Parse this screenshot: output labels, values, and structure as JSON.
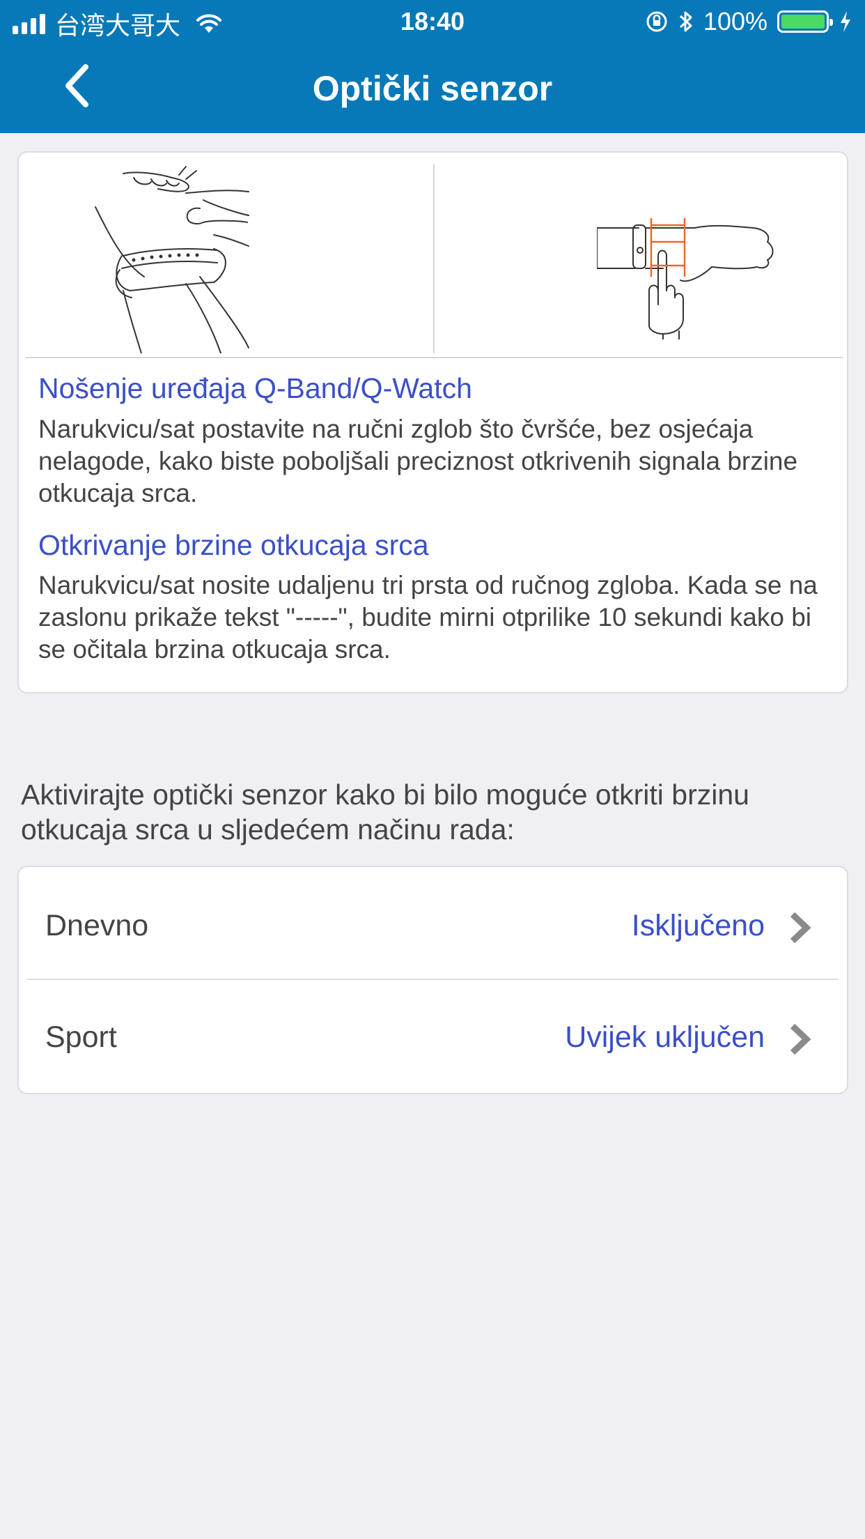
{
  "status_bar": {
    "carrier": "台湾大哥大",
    "time": "18:40",
    "battery": "100%",
    "battery_level": 1.0
  },
  "header": {
    "title": "Optički senzor",
    "back_icon": "chevron-left-icon"
  },
  "info": {
    "sections": [
      {
        "title": "Nošenje uređaja Q-Band/Q-Watch",
        "body": "Narukvicu/sat postavite na ručni zglob što čvršće, bez osjećaja nelagode, kako biste poboljšali preciznost otkrivenih signala brzine otkucaja srca."
      },
      {
        "title": "Otkrivanje brzine otkucaja srca",
        "body": "Narukvicu/sat nosite udaljenu tri prsta od ručnog zgloba. Kada se na zaslonu prikaže tekst \"-----\", budite mirni otprilike 10 sekundi kako bi se očitala brzina otkucaja srca."
      }
    ]
  },
  "description": "Aktivirajte optički senzor kako bi bilo moguće otkriti brzinu otkucaja srca u sljedećem načinu rada:",
  "modes": [
    {
      "label": "Dnevno",
      "value": "Isključeno"
    },
    {
      "label": "Sport",
      "value": "Uvijek uključen"
    }
  ],
  "colors": {
    "header": "#0779b8",
    "accent_text": "#3b4fc7",
    "background": "#efeff4",
    "battery": "#4cd964",
    "illustration_accent": "#e8692a"
  }
}
